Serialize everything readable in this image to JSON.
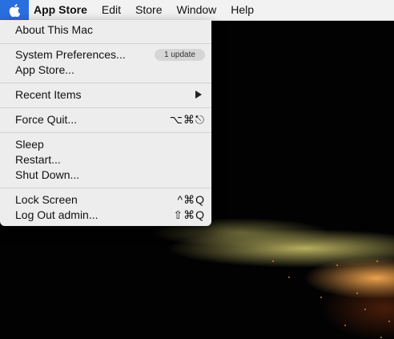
{
  "menubar": {
    "items": [
      "App Store",
      "Edit",
      "Store",
      "Window",
      "Help"
    ]
  },
  "apple_menu": {
    "about": "About This Mac",
    "system_prefs": "System Preferences...",
    "update_badge": "1 update",
    "app_store": "App Store...",
    "recent_items": "Recent Items",
    "force_quit": "Force Quit...",
    "force_quit_shortcut": "⌥⌘⎋",
    "sleep": "Sleep",
    "restart": "Restart...",
    "shut_down": "Shut Down...",
    "lock_screen": "Lock Screen",
    "lock_screen_shortcut": "^⌘Q",
    "log_out": "Log Out admin...",
    "log_out_shortcut": "⇧⌘Q"
  }
}
